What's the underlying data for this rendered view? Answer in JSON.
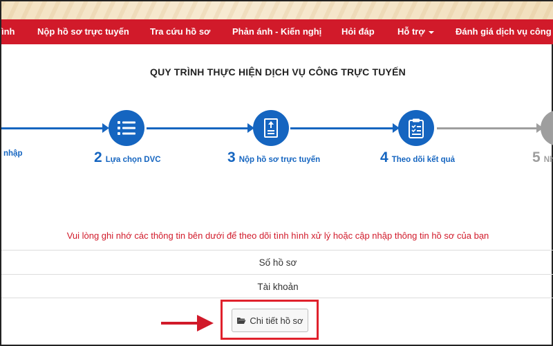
{
  "nav": {
    "items": [
      {
        "label": "ình"
      },
      {
        "label": "Nộp hồ sơ trực tuyến"
      },
      {
        "label": "Tra cứu hồ sơ"
      },
      {
        "label": "Phản ánh - Kiến nghị"
      },
      {
        "label": "Hỏi đáp"
      },
      {
        "label": "Hỗ trợ"
      },
      {
        "label": "Đánh giá dịch vụ công"
      }
    ]
  },
  "process": {
    "title": "QUY TRÌNH THỰC HIỆN DỊCH VỤ CÔNG TRỰC TUYẾN",
    "steps": [
      {
        "num": "",
        "label": "nhập"
      },
      {
        "num": "2",
        "label": "Lựa chọn DVC",
        "icon": "list-icon"
      },
      {
        "num": "3",
        "label": "Nộp hồ sơ trực tuyến",
        "icon": "upload-document-icon"
      },
      {
        "num": "4",
        "label": "Theo dõi kết quả",
        "icon": "clipboard-checklist-icon"
      },
      {
        "num": "5",
        "label": "Nh"
      }
    ]
  },
  "notice": "Vui lòng ghi nhớ các thông tin bên dưới để theo dõi tình hình xử lý hoặc cập nhập thông tin hồ sơ của bạn",
  "info": {
    "rows": [
      {
        "label": "Số hồ sơ"
      },
      {
        "label": "Tài khoản"
      }
    ]
  },
  "detail_button": {
    "label": "Chi tiết hồ sơ",
    "icon": "folder-open-icon"
  },
  "colors": {
    "nav_bg": "#d11a2a",
    "step_active": "#1565c0",
    "step_inactive": "#9e9e9e",
    "notice": "#d11a2a",
    "highlight": "#e0212c"
  }
}
